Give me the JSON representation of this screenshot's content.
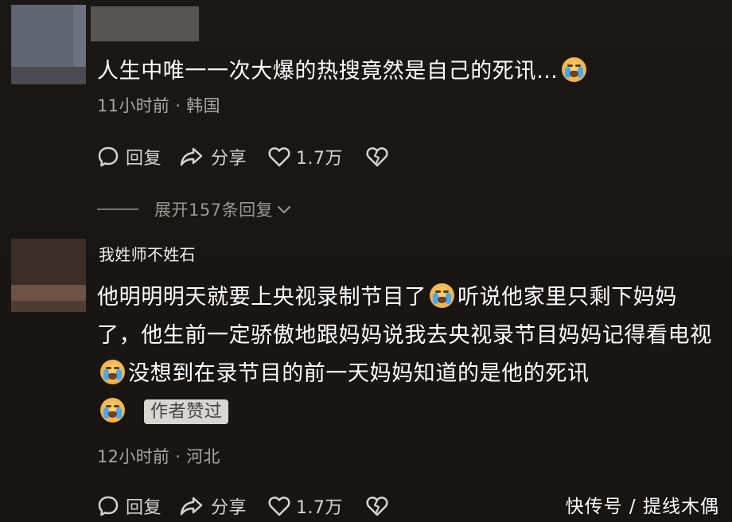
{
  "comments": [
    {
      "text": "人生中唯一一次大爆的热搜竟然是自己的死讯…",
      "meta": "11小时前 · 韩国",
      "actions": {
        "reply_label": "回复",
        "share_label": "分享",
        "like_count": "1.7万"
      },
      "expand_replies": "展开157条回复"
    },
    {
      "username": "我姓师不姓石",
      "text_1": "他明明明天就要上央视录制节目了",
      "text_2": "听说他家里只剩下妈妈了，他生前一定骄傲地跟妈妈说我去央视录节目妈妈记得看电视",
      "text_3": "没想到在录节目的前一天妈妈知道的是他的死讯",
      "badge": "作者赞过",
      "meta": "12小时前 · 河北",
      "actions": {
        "reply_label": "回复",
        "share_label": "分享",
        "like_count": "1.7万"
      }
    }
  ],
  "watermark": "快传号 / 提线木偶",
  "icons": {
    "emoji": "crying-face-icon",
    "reply": "reply-bubble-icon",
    "share": "share-arrow-icon",
    "like": "heart-icon",
    "dislike": "broken-heart-icon",
    "expand": "chevron-down-icon"
  },
  "colors": {
    "background": "#181513",
    "primary_text": "#ffffff",
    "meta_text": "#aaa59f",
    "badge_background": "#d9d5d0"
  }
}
